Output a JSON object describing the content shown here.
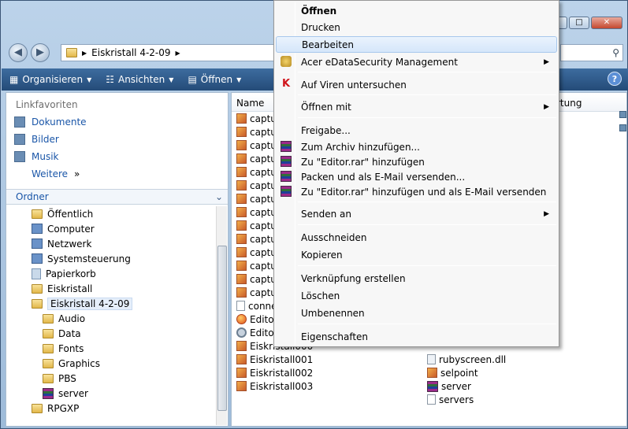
{
  "address": {
    "crumb": "Eiskristall 4-2-09"
  },
  "toolbar": {
    "organize": "Organisieren",
    "views": "Ansichten",
    "open": "Öffnen",
    "help": "?"
  },
  "nav": {
    "favorites_title": "Linkfavoriten",
    "favorites": [
      "Dokumente",
      "Bilder",
      "Musik"
    ],
    "more": "Weitere",
    "more_glyph": "»",
    "folders_title": "Ordner",
    "tree": [
      "Öffentlich",
      "Computer",
      "Netzwerk",
      "Systemsteuerung",
      "Papierkorb",
      "Eiskristall",
      "Eiskristall 4-2-09",
      "Audio",
      "Data",
      "Fonts",
      "Graphics",
      "PBS",
      "server",
      "RPGXP"
    ]
  },
  "columns": {
    "name": "Name",
    "type_partial": "rtung"
  },
  "files_left": [
    "captu",
    "captu",
    "captu",
    "captu",
    "captu",
    "captu",
    "captu",
    "captu",
    "captu",
    "captu",
    "captu",
    "captu",
    "captu",
    "captu",
    "conne",
    "Editor",
    "Editor",
    "Eiskristall000",
    "Eiskristall001",
    "Eiskristall002",
    "Eiskristall003"
  ],
  "files_right": [
    "rubyscreen.dll",
    "selpoint",
    "server",
    "servers"
  ],
  "menu": {
    "open": "Öffnen",
    "print": "Drucken",
    "edit": "Bearbeiten",
    "acer": "Acer eDataSecurity Management",
    "virus": "Auf Viren untersuchen",
    "open_with": "Öffnen mit",
    "share": "Freigabe...",
    "add_archive": "Zum Archiv hinzufügen...",
    "add_rar": "Zu \"Editor.rar\" hinzufügen",
    "pack_email": "Packen und als E-Mail versenden...",
    "add_rar_email": "Zu \"Editor.rar\" hinzufügen und als E-Mail versenden",
    "send_to": "Senden an",
    "cut": "Ausschneiden",
    "copy": "Kopieren",
    "shortcut": "Verknüpfung erstellen",
    "delete": "Löschen",
    "rename": "Umbenennen",
    "properties": "Eigenschaften"
  }
}
